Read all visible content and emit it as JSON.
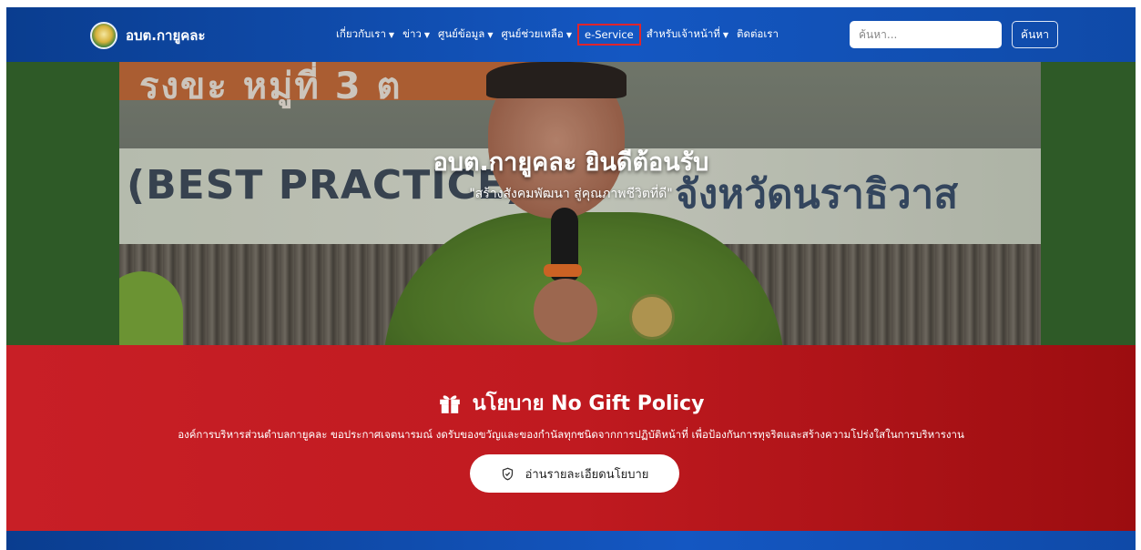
{
  "navbar": {
    "brand": "อบต.กายูคละ",
    "menu": [
      {
        "label": "เกี่ยวกับเรา",
        "dropdown": true
      },
      {
        "label": "ข่าว",
        "dropdown": true
      },
      {
        "label": "ศูนย์ข้อมูล",
        "dropdown": true
      },
      {
        "label": "ศูนย์ช่วยเหลือ",
        "dropdown": true
      },
      {
        "label": "e-Service",
        "dropdown": false,
        "highlighted": true
      },
      {
        "label": "สำหรับเจ้าหน้าที่",
        "dropdown": true
      },
      {
        "label": "ติดต่อเรา",
        "dropdown": false
      }
    ],
    "caret": "▼",
    "search": {
      "placeholder": "ค้นหา...",
      "button_label": "ค้นหา"
    }
  },
  "hero": {
    "title": "อบต.กายูคละ ยินดีต้อนรับ",
    "subtitle": "\"สร้างสังคมพัฒนา สู่คุณภาพชีวิตที่ดี\"",
    "photo_banner_top": "รงขะ หมู่ที่ 3 ต",
    "photo_banner_text": "(BEST PRACTICE)",
    "photo_banner_thai": "จังหวัดนราธิวาส"
  },
  "policy": {
    "icon": "gift-icon",
    "title": "นโยบาย No Gift Policy",
    "text": "องค์การบริหารส่วนตำบลกายูคละ ขอประกาศเจตนารมณ์ งดรับของขวัญและของกำนัลทุกชนิดจากการปฏิบัติหน้าที่ เพื่อป้องกันการทุจริตและสร้างความโปร่งใสในการบริหารงาน",
    "button_icon": "shield-icon",
    "button_label": "อ่านรายละเอียดนโยบาย"
  },
  "colors": {
    "navbar": "#1457c2",
    "policy_red": "#c01a20",
    "highlight_border": "#e0242c"
  }
}
